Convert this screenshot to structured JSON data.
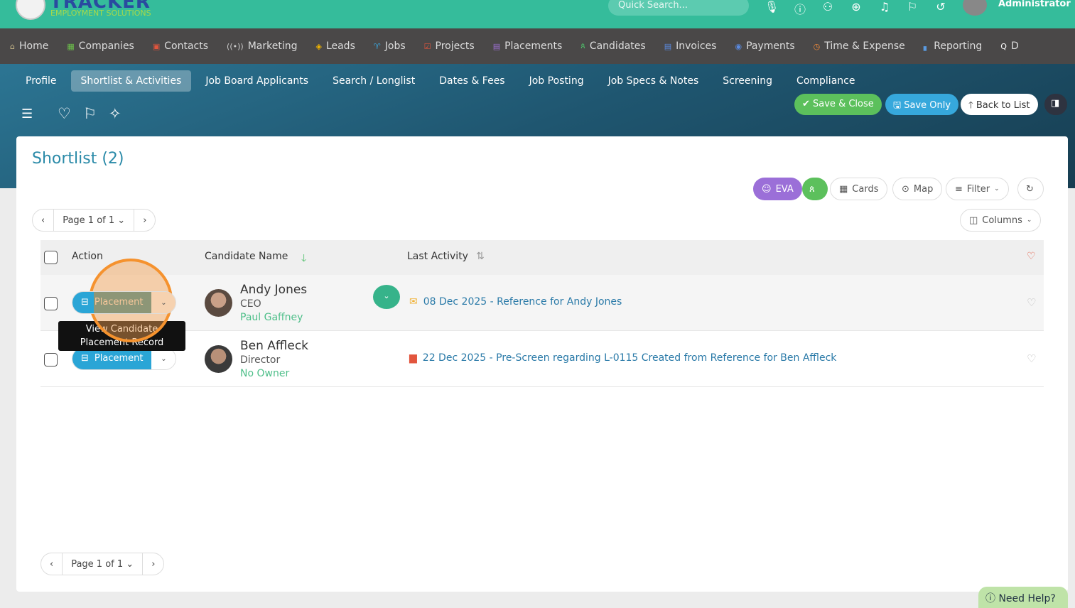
{
  "brand": {
    "name": "TRACKER",
    "tagline": "EMPLOYMENT SOLUTIONS"
  },
  "topbar": {
    "search_placeholder": "Quick Search...",
    "user": "Administrator"
  },
  "nav": [
    {
      "icon": "⌂",
      "label": "Home",
      "color": "#c9b98a"
    },
    {
      "icon": "▦",
      "label": "Companies",
      "color": "#6cc04a"
    },
    {
      "icon": "▣",
      "label": "Contacts",
      "color": "#e2553d"
    },
    {
      "icon": "((•))",
      "label": "Marketing",
      "color": "#ccc"
    },
    {
      "icon": "◈",
      "label": "Leads",
      "color": "#f0b400"
    },
    {
      "icon": "♈",
      "label": "Jobs",
      "color": "#3aa8e0"
    },
    {
      "icon": "☑",
      "label": "Projects",
      "color": "#e2553d"
    },
    {
      "icon": "▤",
      "label": "Placements",
      "color": "#9b6fd0"
    },
    {
      "icon": "ጰ",
      "label": "Candidates",
      "color": "#4fbf6a"
    },
    {
      "icon": "▤",
      "label": "Invoices",
      "color": "#5a8ae0"
    },
    {
      "icon": "◉",
      "label": "Payments",
      "color": "#5a8ae0"
    },
    {
      "icon": "◷",
      "label": "Time & Expense",
      "color": "#f08a3a"
    },
    {
      "icon": "▖",
      "label": "Reporting",
      "color": "#5a9ae0"
    },
    {
      "icon": "Q",
      "label": "D",
      "color": "#fff"
    }
  ],
  "tabs": [
    "Profile",
    "Shortlist & Activities",
    "Job Board Applicants",
    "Search / Longlist",
    "Dates & Fees",
    "Job Posting",
    "Job Specs & Notes",
    "Screening",
    "Compliance"
  ],
  "actions": {
    "save_close": "✔ Save & Close",
    "save_only": "🖫 Save Only",
    "back": "🡑 Back to List"
  },
  "title": "Shortlist (2)",
  "toolbar": {
    "eva": "EVA",
    "cards": "Cards",
    "map": "Map",
    "filter": "Filter",
    "columns": "Columns"
  },
  "pager": {
    "text": "Page 1 of 1"
  },
  "table": {
    "headers": [
      "Action",
      "Candidate Name",
      "Last Activity"
    ],
    "rows": [
      {
        "action": "Placement",
        "name": "Andy Jones",
        "role": "CEO",
        "owner": "Paul Gaffney",
        "activity": "08 Dec 2025 - Reference for Andy Jones"
      },
      {
        "action": "Placement",
        "name": "Ben Affleck",
        "role": "Director",
        "owner": "No Owner",
        "activity": "22 Dec 2025 - Pre-Screen regarding L-0115 Created from Reference for Ben Affleck"
      }
    ]
  },
  "tooltip": {
    "line1": "View Candidate",
    "line2": "Placement Record"
  },
  "help": "Need Help?"
}
